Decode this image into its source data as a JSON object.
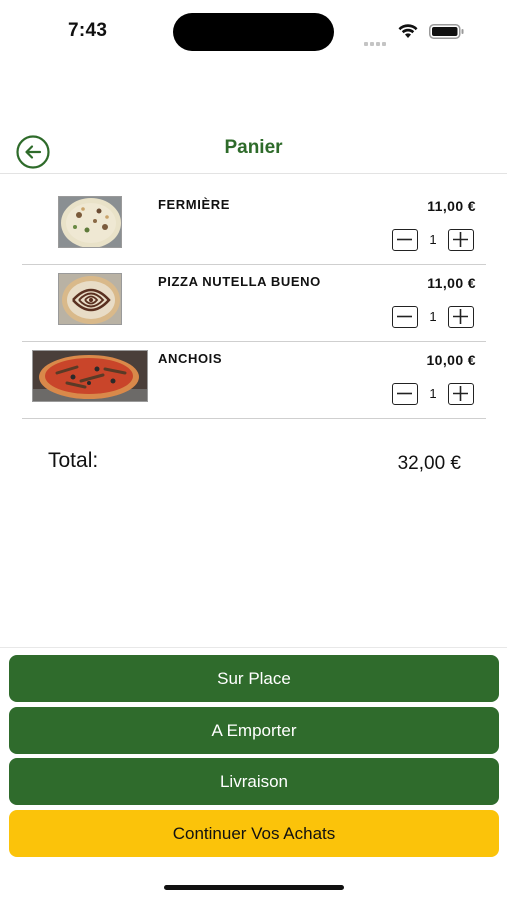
{
  "status_bar": {
    "time": "7:43"
  },
  "header": {
    "title": "Panier",
    "back_icon": "back-arrow-circle-icon",
    "title_color": "#2e6b2a"
  },
  "cart": {
    "items": [
      {
        "name": "FERMIÈRE",
        "price": "11,00 €",
        "quantity": "1",
        "image": "pizza-fermiere-photo"
      },
      {
        "name": "PIZZA NUTELLA BUENO",
        "price": "11,00 €",
        "quantity": "1",
        "image": "pizza-nutella-photo"
      },
      {
        "name": "ANCHOIS",
        "price": "10,00 €",
        "quantity": "1",
        "image": "pizza-anchois-photo"
      }
    ]
  },
  "summary": {
    "total_label": "Total:",
    "total_value": "32,00 €"
  },
  "actions": {
    "sur_place": "Sur Place",
    "a_emporter": "A Emporter",
    "livraison": "Livraison",
    "continuer": "Continuer Vos Achats",
    "green_color": "#2f6b2c",
    "yellow_color": "#fbc30a"
  }
}
